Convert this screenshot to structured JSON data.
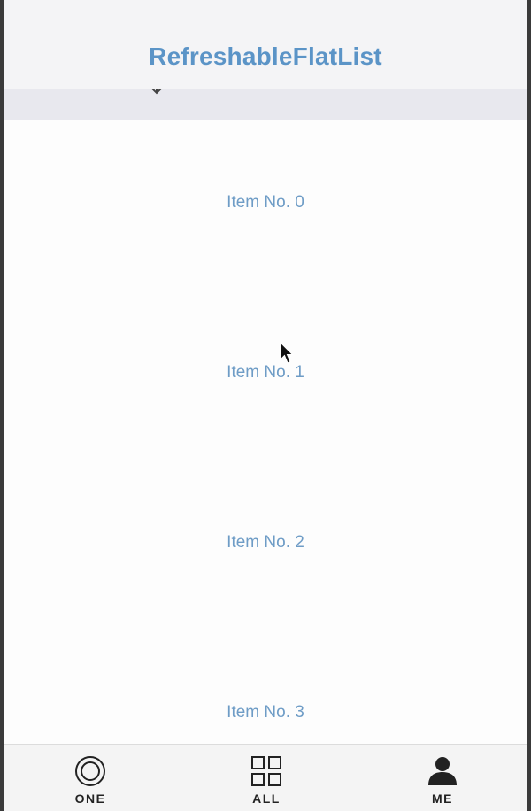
{
  "header": {
    "title": "RefreshableFlatList"
  },
  "refresh_indicator": {
    "icon": "arrow-down-icon"
  },
  "list": {
    "items": [
      {
        "label": "Item No. 0"
      },
      {
        "label": "Item No. 1"
      },
      {
        "label": "Item No. 2"
      },
      {
        "label": "Item No. 3"
      }
    ]
  },
  "tab_bar": {
    "tabs": [
      {
        "label": "ONE",
        "icon": "target-circle-icon"
      },
      {
        "label": "ALL",
        "icon": "grid-icon"
      },
      {
        "label": "ME",
        "icon": "person-icon"
      }
    ]
  },
  "colors": {
    "title": "#5b94c7",
    "item_text": "#6e9cc6",
    "tab_text": "#222222"
  }
}
